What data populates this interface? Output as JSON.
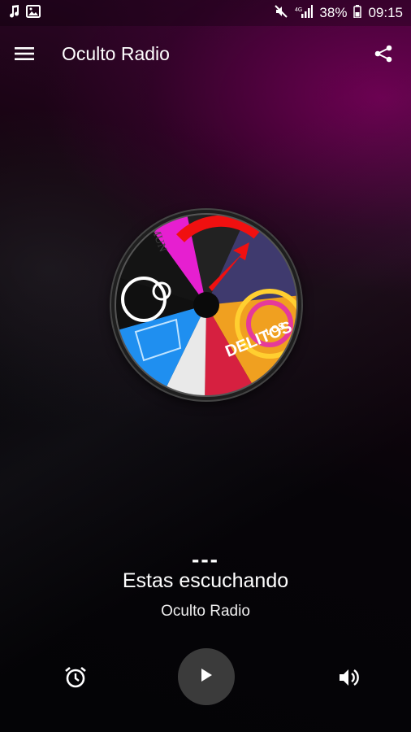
{
  "status_bar": {
    "left_icons": [
      "music-note-icon",
      "image-icon"
    ],
    "right_icons": [
      "mute-icon",
      "signal-icon",
      "battery-icon"
    ],
    "battery": "38%",
    "time": "09:15"
  },
  "app_bar": {
    "title": "Oculto Radio",
    "menu_icon": "hamburger-menu-icon",
    "share_icon": "share-icon"
  },
  "album_art": {
    "text_1": "LOS",
    "text_2": "DELITOS",
    "text_3": "MUN"
  },
  "now_playing": {
    "track": "---",
    "label": "Estas escuchando",
    "station": "Oculto Radio"
  },
  "controls": {
    "alarm_icon": "alarm-clock-icon",
    "play_icon": "play-icon",
    "volume_icon": "volume-icon"
  },
  "colors": {
    "accent_purple": "#4a063e",
    "play_button_bg": "#3b3b3b",
    "text": "#ffffff"
  }
}
